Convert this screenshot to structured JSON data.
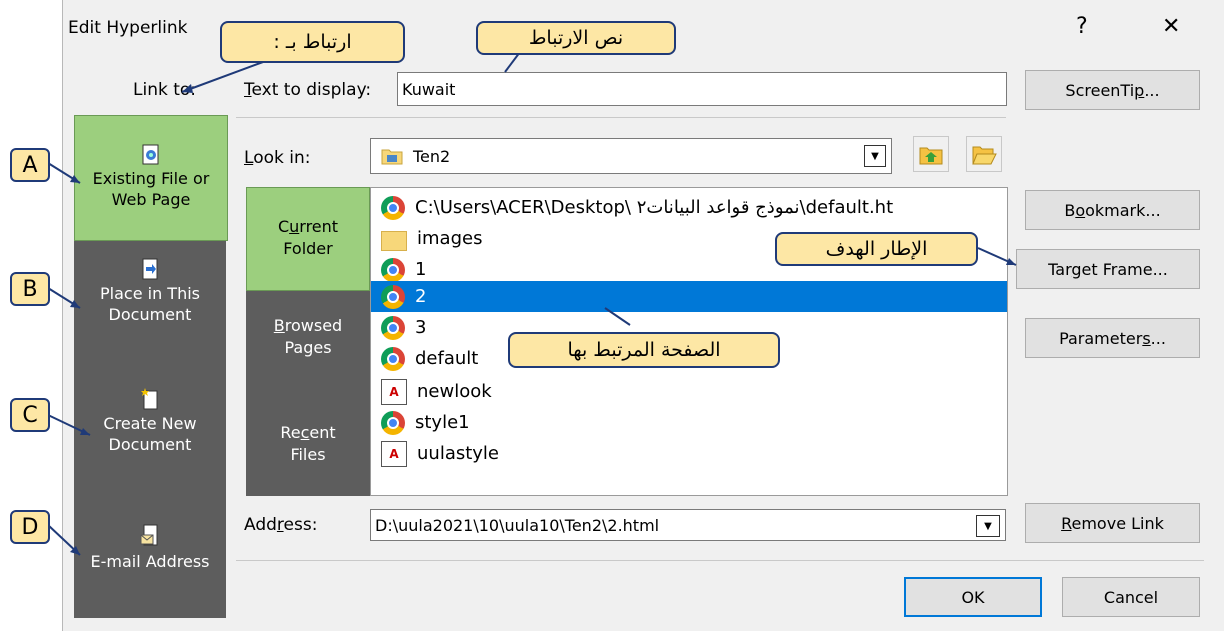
{
  "dialog": {
    "title": "Edit Hyperlink",
    "help": "?",
    "close": "✕"
  },
  "labels": {
    "link_to": "Link to:",
    "text_to_display": "Text to display:",
    "look_in": "Look in:",
    "address": "Address:"
  },
  "fields": {
    "text_to_display_value": "Kuwait",
    "look_in_value": "Ten2",
    "address_value": "D:\\uula2021\\10\\uula10\\Ten2\\2.html"
  },
  "link_to_items": [
    {
      "label_line1": "Existing File or",
      "label_line2": "Web Page",
      "icon": "web-page-icon"
    },
    {
      "label_line1": "Place in This",
      "label_line2": "Document",
      "icon": "place-in-document-icon"
    },
    {
      "label_line1": "Create New",
      "label_line2": "Document",
      "icon": "new-document-icon"
    },
    {
      "label_line1": "E-mail Address",
      "label_line2": "",
      "icon": "email-icon"
    }
  ],
  "side_tabs": [
    {
      "label_line1": "Current",
      "label_line2": "Folder"
    },
    {
      "label_line1": "Browsed",
      "label_line2": "Pages"
    },
    {
      "label_line1": "Recent",
      "label_line2": "Files"
    }
  ],
  "files": [
    {
      "name": "C:\\Users\\ACER\\Desktop\\ نموذج قواعد البيانات٢\\default.ht",
      "icon": "chrome"
    },
    {
      "name": "images",
      "icon": "folder"
    },
    {
      "name": "1",
      "icon": "chrome"
    },
    {
      "name": "2",
      "icon": "chrome",
      "selected": true
    },
    {
      "name": "3",
      "icon": "chrome"
    },
    {
      "name": "default",
      "icon": "chrome"
    },
    {
      "name": "newlook",
      "icon": "doc"
    },
    {
      "name": "style1",
      "icon": "chrome"
    },
    {
      "name": "uulastyle",
      "icon": "doc"
    }
  ],
  "buttons": {
    "screentip": "ScreenTip...",
    "bookmark": "Bookmark...",
    "target_frame": "Target Frame...",
    "parameters": "Parameters...",
    "remove_link": "Remove Link",
    "ok": "OK",
    "cancel": "Cancel"
  },
  "callouts": {
    "link_to": "ارتباط بـ :",
    "link_text": "نص الارتباط",
    "target_frame": "الإطار الهدف",
    "linked_page": "الصفحة المرتبط بها"
  },
  "letters": [
    "A",
    "B",
    "C",
    "D"
  ],
  "colors": {
    "selected_link_item": "#9ccf7e",
    "link_pane": "#5d5d5d",
    "selection": "#0078d7",
    "callout_fill": "#fde7a5",
    "callout_border": "#1f3a78"
  }
}
